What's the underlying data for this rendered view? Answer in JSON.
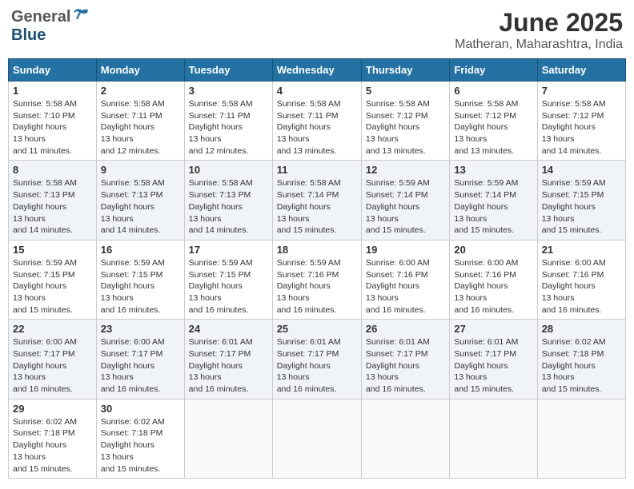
{
  "header": {
    "logo_general": "General",
    "logo_blue": "Blue",
    "month": "June 2025",
    "location": "Matheran, Maharashtra, India"
  },
  "days_of_week": [
    "Sunday",
    "Monday",
    "Tuesday",
    "Wednesday",
    "Thursday",
    "Friday",
    "Saturday"
  ],
  "weeks": [
    [
      {
        "day": 1,
        "sunrise": "5:58 AM",
        "sunset": "7:10 PM",
        "daylight": "13 hours and 11 minutes."
      },
      {
        "day": 2,
        "sunrise": "5:58 AM",
        "sunset": "7:11 PM",
        "daylight": "13 hours and 12 minutes."
      },
      {
        "day": 3,
        "sunrise": "5:58 AM",
        "sunset": "7:11 PM",
        "daylight": "13 hours and 12 minutes."
      },
      {
        "day": 4,
        "sunrise": "5:58 AM",
        "sunset": "7:11 PM",
        "daylight": "13 hours and 13 minutes."
      },
      {
        "day": 5,
        "sunrise": "5:58 AM",
        "sunset": "7:12 PM",
        "daylight": "13 hours and 13 minutes."
      },
      {
        "day": 6,
        "sunrise": "5:58 AM",
        "sunset": "7:12 PM",
        "daylight": "13 hours and 13 minutes."
      },
      {
        "day": 7,
        "sunrise": "5:58 AM",
        "sunset": "7:12 PM",
        "daylight": "13 hours and 14 minutes."
      }
    ],
    [
      {
        "day": 8,
        "sunrise": "5:58 AM",
        "sunset": "7:13 PM",
        "daylight": "13 hours and 14 minutes."
      },
      {
        "day": 9,
        "sunrise": "5:58 AM",
        "sunset": "7:13 PM",
        "daylight": "13 hours and 14 minutes."
      },
      {
        "day": 10,
        "sunrise": "5:58 AM",
        "sunset": "7:13 PM",
        "daylight": "13 hours and 14 minutes."
      },
      {
        "day": 11,
        "sunrise": "5:58 AM",
        "sunset": "7:14 PM",
        "daylight": "13 hours and 15 minutes."
      },
      {
        "day": 12,
        "sunrise": "5:59 AM",
        "sunset": "7:14 PM",
        "daylight": "13 hours and 15 minutes."
      },
      {
        "day": 13,
        "sunrise": "5:59 AM",
        "sunset": "7:14 PM",
        "daylight": "13 hours and 15 minutes."
      },
      {
        "day": 14,
        "sunrise": "5:59 AM",
        "sunset": "7:15 PM",
        "daylight": "13 hours and 15 minutes."
      }
    ],
    [
      {
        "day": 15,
        "sunrise": "5:59 AM",
        "sunset": "7:15 PM",
        "daylight": "13 hours and 15 minutes."
      },
      {
        "day": 16,
        "sunrise": "5:59 AM",
        "sunset": "7:15 PM",
        "daylight": "13 hours and 16 minutes."
      },
      {
        "day": 17,
        "sunrise": "5:59 AM",
        "sunset": "7:15 PM",
        "daylight": "13 hours and 16 minutes."
      },
      {
        "day": 18,
        "sunrise": "5:59 AM",
        "sunset": "7:16 PM",
        "daylight": "13 hours and 16 minutes."
      },
      {
        "day": 19,
        "sunrise": "6:00 AM",
        "sunset": "7:16 PM",
        "daylight": "13 hours and 16 minutes."
      },
      {
        "day": 20,
        "sunrise": "6:00 AM",
        "sunset": "7:16 PM",
        "daylight": "13 hours and 16 minutes."
      },
      {
        "day": 21,
        "sunrise": "6:00 AM",
        "sunset": "7:16 PM",
        "daylight": "13 hours and 16 minutes."
      }
    ],
    [
      {
        "day": 22,
        "sunrise": "6:00 AM",
        "sunset": "7:17 PM",
        "daylight": "13 hours and 16 minutes."
      },
      {
        "day": 23,
        "sunrise": "6:00 AM",
        "sunset": "7:17 PM",
        "daylight": "13 hours and 16 minutes."
      },
      {
        "day": 24,
        "sunrise": "6:01 AM",
        "sunset": "7:17 PM",
        "daylight": "13 hours and 16 minutes."
      },
      {
        "day": 25,
        "sunrise": "6:01 AM",
        "sunset": "7:17 PM",
        "daylight": "13 hours and 16 minutes."
      },
      {
        "day": 26,
        "sunrise": "6:01 AM",
        "sunset": "7:17 PM",
        "daylight": "13 hours and 16 minutes."
      },
      {
        "day": 27,
        "sunrise": "6:01 AM",
        "sunset": "7:17 PM",
        "daylight": "13 hours and 15 minutes."
      },
      {
        "day": 28,
        "sunrise": "6:02 AM",
        "sunset": "7:18 PM",
        "daylight": "13 hours and 15 minutes."
      }
    ],
    [
      {
        "day": 29,
        "sunrise": "6:02 AM",
        "sunset": "7:18 PM",
        "daylight": "13 hours and 15 minutes."
      },
      {
        "day": 30,
        "sunrise": "6:02 AM",
        "sunset": "7:18 PM",
        "daylight": "13 hours and 15 minutes."
      },
      null,
      null,
      null,
      null,
      null
    ]
  ],
  "labels": {
    "sunrise": "Sunrise:",
    "sunset": "Sunset:",
    "daylight": "Daylight hours"
  }
}
